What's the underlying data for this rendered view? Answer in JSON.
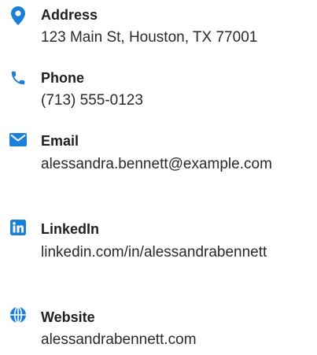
{
  "accent_color": "#1b7fd8",
  "contacts": {
    "address": {
      "icon": "map-pin-icon",
      "label": "Address",
      "value": "123 Main St, Houston, TX 77001"
    },
    "phone": {
      "icon": "phone-icon",
      "label": "Phone",
      "value": "(713) 555-0123"
    },
    "email": {
      "icon": "envelope-icon",
      "label": "Email",
      "value": "alessandra.bennett@example.com"
    },
    "linkedin": {
      "icon": "linkedin-icon",
      "label": "LinkedIn",
      "value": "linkedin.com/in/alessandrabennett"
    },
    "website": {
      "icon": "globe-icon",
      "label": "Website",
      "value": "alessandrabennett.com"
    }
  }
}
